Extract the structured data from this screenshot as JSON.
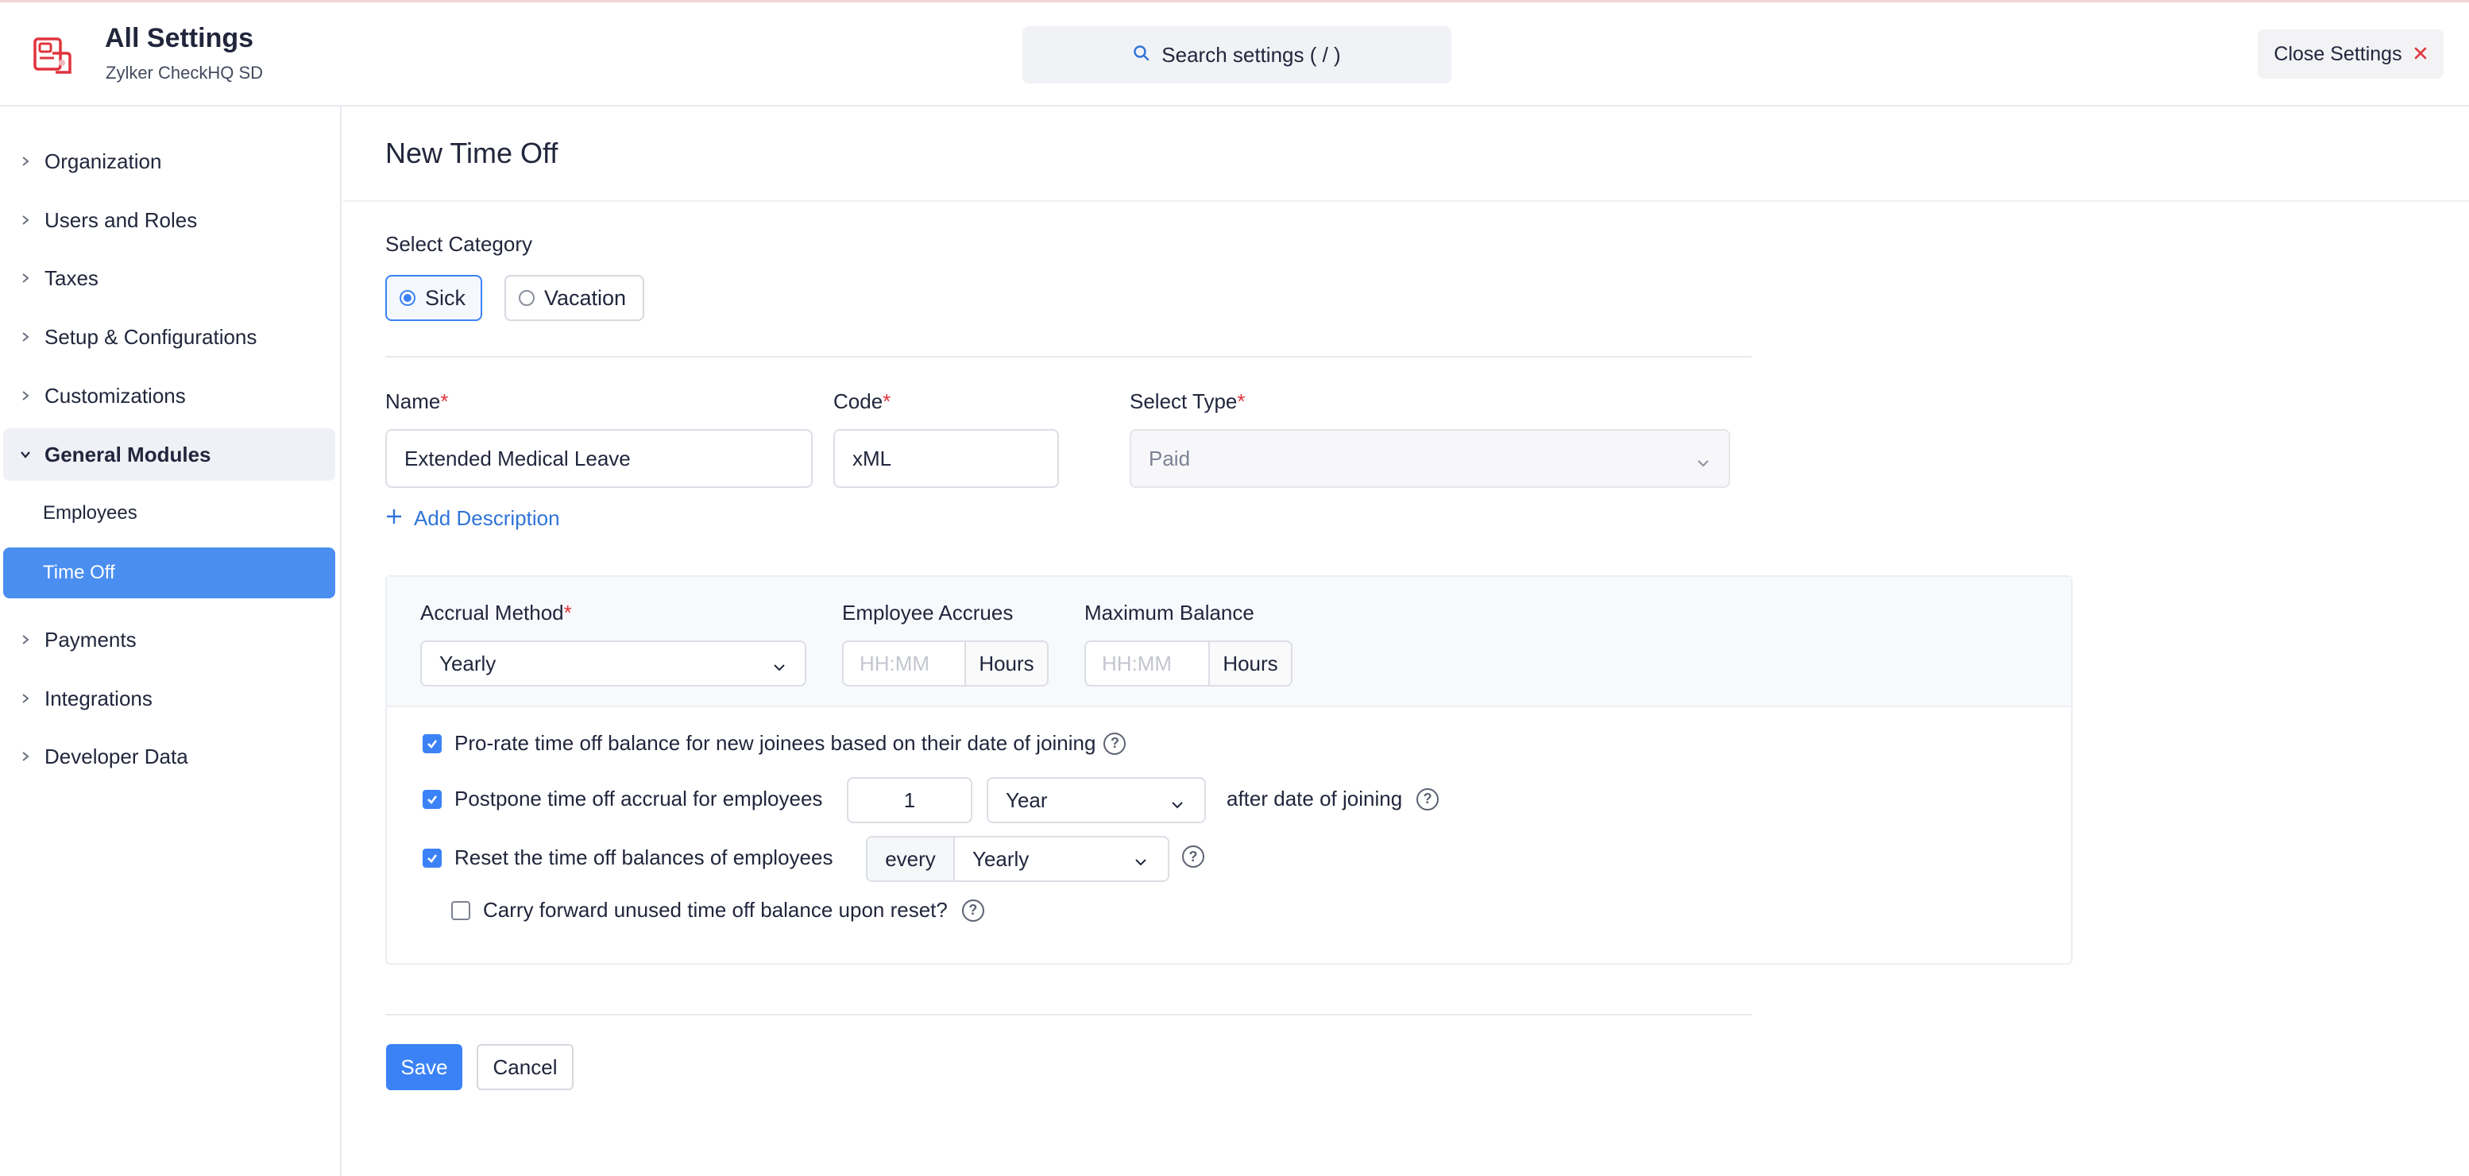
{
  "header": {
    "title": "All Settings",
    "org": "Zylker CheckHQ SD",
    "search_placeholder": "Search settings ( / )",
    "close_label": "Close Settings"
  },
  "sidebar": {
    "items": [
      {
        "label": "Organization"
      },
      {
        "label": "Users and Roles"
      },
      {
        "label": "Taxes"
      },
      {
        "label": "Setup & Configurations"
      },
      {
        "label": "Customizations"
      },
      {
        "label": "General Modules"
      },
      {
        "label": "Payments"
      },
      {
        "label": "Integrations"
      },
      {
        "label": "Developer Data"
      }
    ],
    "sub_items": [
      {
        "label": "Employees"
      },
      {
        "label": "Time Off"
      }
    ]
  },
  "form": {
    "page_title": "New Time Off",
    "category_label": "Select Category",
    "category_options": [
      {
        "label": "Sick",
        "selected": true
      },
      {
        "label": "Vacation",
        "selected": false
      }
    ],
    "name_label": "Name",
    "name_value": "Extended Medical Leave",
    "code_label": "Code",
    "code_value": "xML",
    "type_label": "Select Type",
    "type_value": "Paid",
    "required_mark": "*",
    "add_description": "Add Description",
    "accrual_method_label": "Accrual Method",
    "accrual_method_value": "Yearly",
    "employee_accrues_label": "Employee Accrues",
    "employee_accrues_placeholder": "HH:MM",
    "employee_accrues_unit": "Hours",
    "max_balance_label": "Maximum Balance",
    "max_balance_placeholder": "HH:MM",
    "max_balance_unit": "Hours",
    "prorate_label": "Pro-rate time off balance for new joinees based on their date of joining",
    "prorate_checked": true,
    "postpone_label": "Postpone time off accrual for employees",
    "postpone_checked": true,
    "postpone_value": "1",
    "postpone_unit": "Year",
    "postpone_suffix": "after date of joining",
    "reset_label": "Reset the time off balances of employees",
    "reset_checked": true,
    "reset_prefix": "every",
    "reset_value": "Yearly",
    "carry_label": "Carry forward unused time off balance upon reset?",
    "carry_checked": false,
    "help_glyph": "?",
    "save_label": "Save",
    "cancel_label": "Cancel"
  },
  "colors": {
    "accent": "#3b82f6",
    "brand_logo": "#e0343e",
    "required": "#e0343e"
  }
}
